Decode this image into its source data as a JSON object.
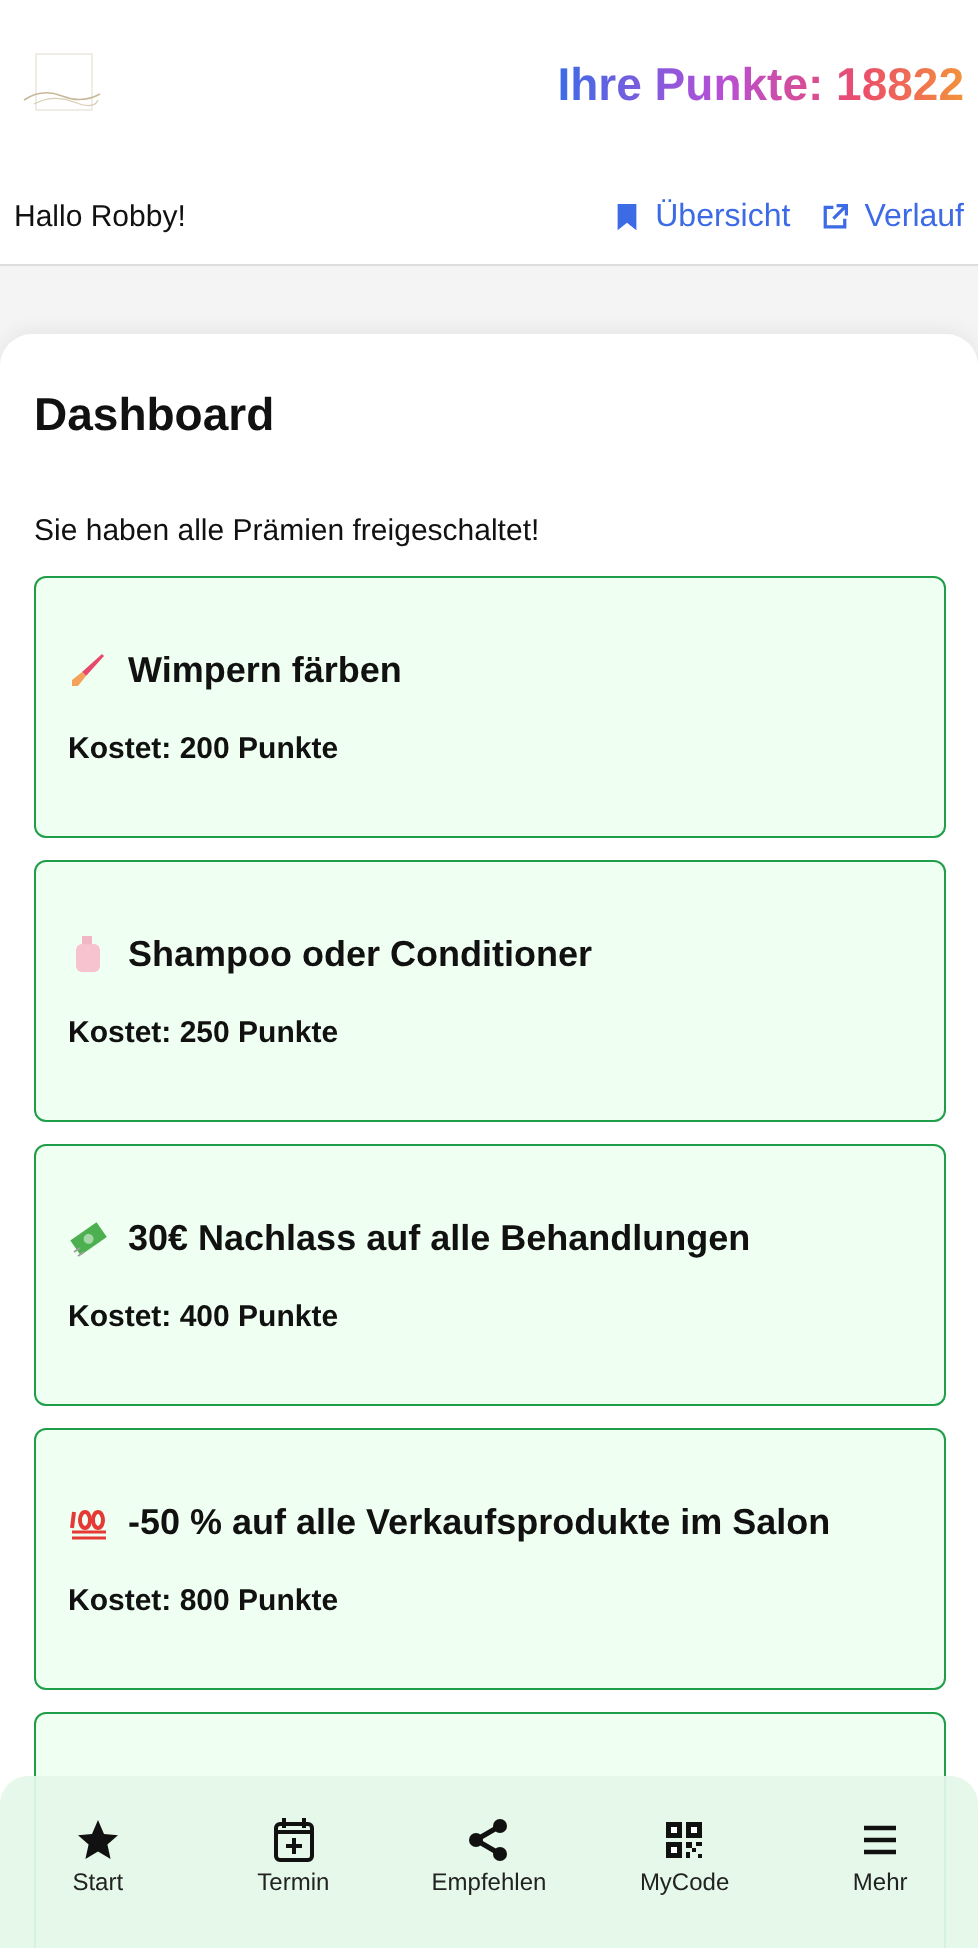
{
  "header": {
    "points_label": "Ihre Punkte:",
    "points": "18822"
  },
  "subheader": {
    "greeting": "Hallo Robby!",
    "links": [
      {
        "label": "Übersicht"
      },
      {
        "label": "Verlauf"
      }
    ]
  },
  "dashboard": {
    "title": "Dashboard",
    "message": "Sie haben alle Prämien freigeschaltet!",
    "rewards": [
      {
        "title": "Wimpern färben",
        "cost": "Kostet: 200 Punkte"
      },
      {
        "title": "Shampoo oder Conditioner",
        "cost": "Kostet: 250 Punkte"
      },
      {
        "title": "30€ Nachlass auf alle Behandlungen",
        "cost": "Kostet: 400 Punkte"
      },
      {
        "title": "-50 % auf alle Verkaufsprodukte im Salon",
        "cost": "Kostet: 800 Punkte"
      }
    ]
  },
  "bottom_nav": [
    {
      "label": "Start"
    },
    {
      "label": "Termin"
    },
    {
      "label": "Empfehlen"
    },
    {
      "label": "MyCode"
    },
    {
      "label": "Mehr"
    }
  ]
}
